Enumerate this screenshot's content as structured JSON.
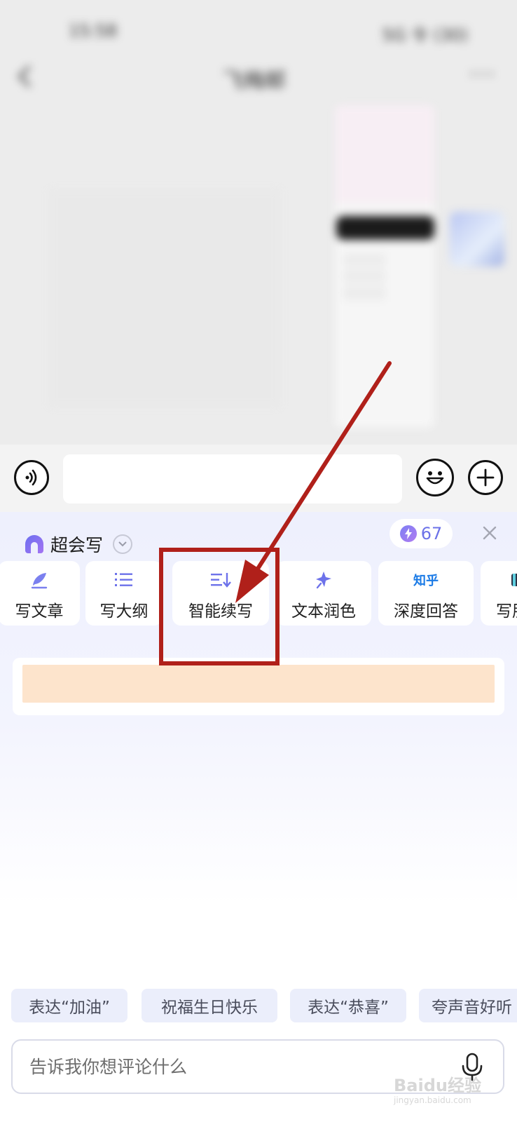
{
  "background_chat": {
    "status_time": "15:58",
    "status_icons": "5G 令 (30)",
    "title": "飞梅邮",
    "more": "···"
  },
  "assistant": {
    "brand_name": "超会写",
    "credits": "67",
    "close_icon": "close-icon",
    "tools": [
      {
        "label": "写文章",
        "icon": "quill-icon"
      },
      {
        "label": "写大纲",
        "icon": "list-icon"
      },
      {
        "label": "智能续写",
        "icon": "continue-writing-icon"
      },
      {
        "label": "文本润色",
        "icon": "sparkle-icon"
      },
      {
        "label": "深度回答",
        "icon": "zhihu-icon",
        "icon_text": "知乎"
      },
      {
        "label": "写朋",
        "icon": "card-icon"
      }
    ],
    "suggestion_chips": [
      "表达“加油”",
      "祝福生日快乐",
      "表达“恭喜”",
      "夸声音好听"
    ],
    "prompt_placeholder": "告诉我你想评论什么"
  },
  "watermark": {
    "text": "Baidu经验",
    "sub": "jingyan.baidu.com"
  },
  "colors": {
    "accent": "#6d72ea",
    "annotation": "#b0201a",
    "highlight_fill": "#fde4cc"
  }
}
